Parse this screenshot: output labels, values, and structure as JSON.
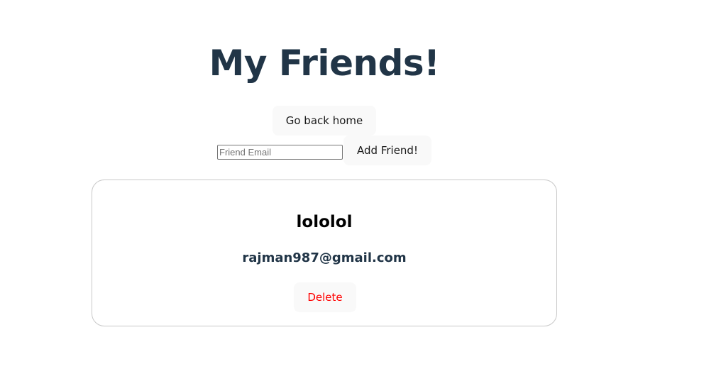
{
  "header": {
    "title": "My Friends!"
  },
  "actions": {
    "home_label": "Go back home",
    "add_label": "Add Friend!"
  },
  "add_friend": {
    "placeholder": "Friend Email",
    "value": ""
  },
  "friends": [
    {
      "name": "lololol",
      "email": "rajman987@gmail.com",
      "delete_label": "Delete"
    }
  ],
  "colors": {
    "heading": "#213547",
    "button_bg": "#f9f9f9",
    "delete_text": "#ff0000",
    "card_border": "#c8c8c8"
  }
}
